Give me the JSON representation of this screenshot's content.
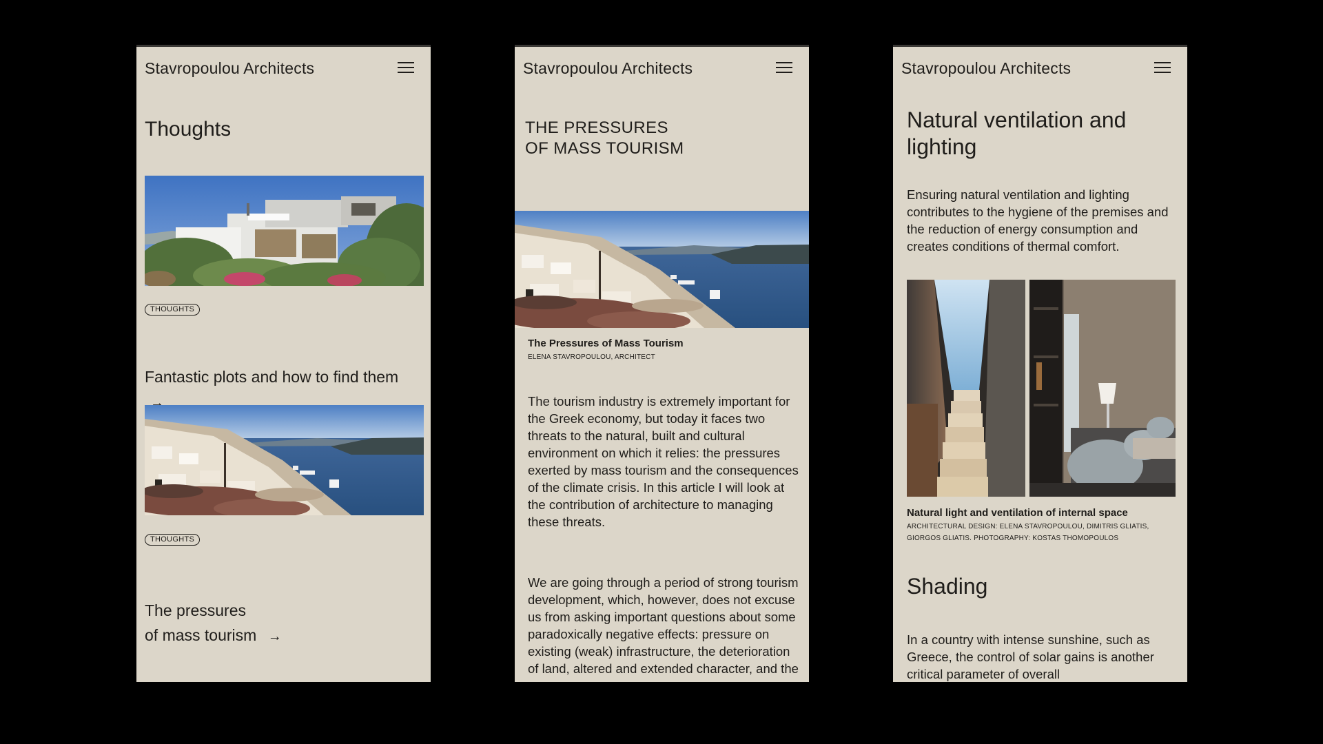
{
  "brand": "Stavropoulou Architects",
  "menu_icon": "hamburger-menu-icon",
  "screens": [
    {
      "page_title": "Thoughts",
      "cards": [
        {
          "tag": "THOUGHTS",
          "title": "Fantastic plots and how to find them",
          "arrow": "→"
        },
        {
          "tag": "THOUGHTS",
          "title_line1": "The pressures",
          "title_line2": "of mass tourism",
          "arrow": "→"
        }
      ]
    },
    {
      "article_title_line1": "THE PRESSURES",
      "article_title_line2": "OF MASS TOURISM",
      "caption_title": "The Pressures of Mass Tourism",
      "caption_credit": "ELENA STAVROPOULOU, ARCHITECT",
      "paragraphs": [
        "The tourism industry is extremely important for the Greek economy, but today it faces two threats to the natural, built and cultural environment on which it relies: the pressures exerted by mass tourism and the consequences of the climate crisis. In this article I will look at the contribution of architecture to managing these threats.",
        "We are going through a period of strong tourism development, which, however, does not excuse us from asking important questions about some paradoxically negative effects: pressure on existing (weak) infrastructure, the deterioration of land, altered and extended character, and the"
      ]
    },
    {
      "section_title": "Natural ventilation and lighting",
      "intro": "Ensuring natural ventilation and lighting contributes to the hygiene of the premises and the reduction of energy consumption and creates conditions of thermal comfort.",
      "caption_title": "Natural light and ventilation of internal space",
      "caption_credit": "ARCHITECTURAL DESIGN: ELENA STAVROPOULOU, DIMITRIS GLIATIS, GIORGOS GLIATIS. PHOTOGRAPHY: KOSTAS THOMOPOULOS",
      "subheading": "Shading",
      "body": "In a country with intense sunshine, such as Greece, the control of solar gains is another critical parameter of overall"
    }
  ],
  "colors": {
    "background": "#000000",
    "screen": "#dcd6c9",
    "text": "#1f1d1a"
  }
}
